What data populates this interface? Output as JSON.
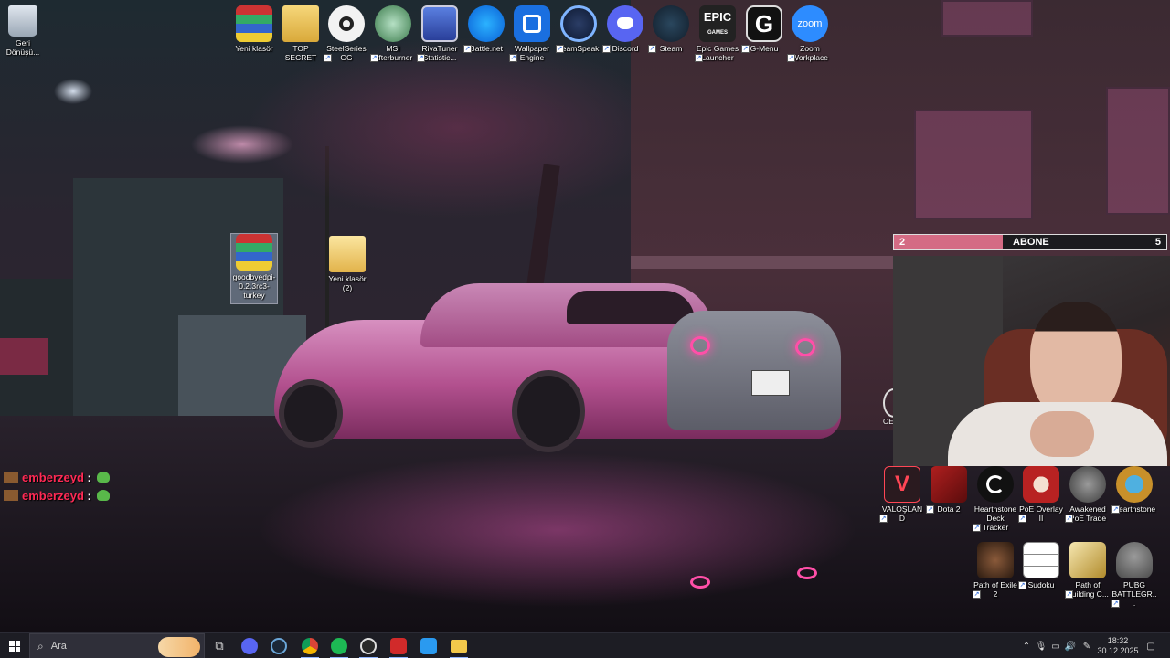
{
  "desktop_icons_top": [
    {
      "label": "Yeni klasör"
    },
    {
      "label": "TOP SECRET"
    },
    {
      "label": "SteelSeries GG"
    },
    {
      "label": "MSI Afterburner"
    },
    {
      "label": "RivaTuner Statistic..."
    },
    {
      "label": "Battle.net"
    },
    {
      "label": "Wallpaper Engine"
    },
    {
      "label": "TeamSpeak"
    },
    {
      "label": "Discord"
    },
    {
      "label": "Steam"
    },
    {
      "label": "Epic Games Launcher"
    },
    {
      "label": "G-Menu"
    },
    {
      "label": "Zoom Workplace"
    }
  ],
  "recycle_bin": {
    "label": "Geri Dönüşü..."
  },
  "desktop_icons_mid": [
    {
      "label": "goodbyedpi-0.2.3rc3-turkey"
    },
    {
      "label": "Yeni klasör (2)"
    }
  ],
  "partial_icon": {
    "label": "OE"
  },
  "desktop_icons_right_row1": [
    {
      "label": "VALOŞLAND"
    },
    {
      "label": "Dota 2"
    },
    {
      "label": "Hearthstone Deck Tracker"
    },
    {
      "label": "PoE Overlay II"
    },
    {
      "label": "Awakened PoE Trade"
    },
    {
      "label": "Hearthstone"
    }
  ],
  "desktop_icons_right_row2": [
    {
      "label": "Path of Exile 2"
    },
    {
      "label": "Sudoku"
    },
    {
      "label": "Path of Building C..."
    },
    {
      "label": "PUBG BATTLEGR..."
    }
  ],
  "overlay": {
    "subscriber_bar": {
      "current": "2",
      "label": "ABONE",
      "goal": "5",
      "progress": 0.4
    }
  },
  "chat": [
    {
      "user": "emberzeyd",
      "colon": ":"
    },
    {
      "user": "emberzeyd",
      "colon": ":"
    }
  ],
  "taskbar": {
    "search_placeholder": "Ara",
    "clock_time": "18:32",
    "clock_date": "30.12.2025"
  },
  "colors": {
    "accent_pink": "#d46b84",
    "taskbar": "#1d1d24"
  }
}
